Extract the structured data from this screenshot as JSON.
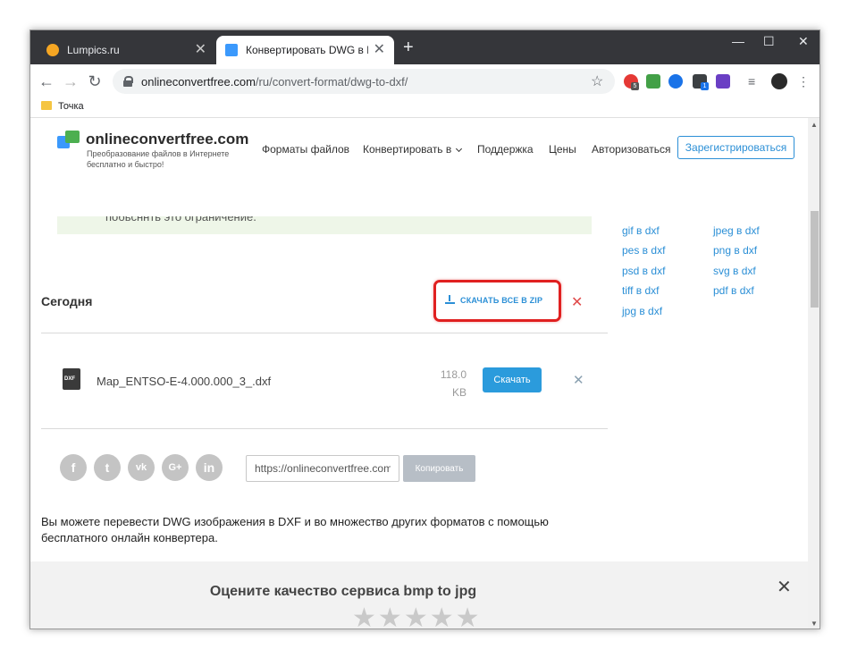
{
  "browser": {
    "tabs": [
      {
        "label": "Lumpics.ru",
        "favicon_color": "#f5a623"
      },
      {
        "label": "Конвертировать DWG в DXF он",
        "favicon_color": "#3b99fc"
      }
    ],
    "new_tab": "+",
    "window_controls": {
      "minimize": "—",
      "maximize": "☐",
      "close": "✕"
    },
    "address": {
      "host": "onlineconvertfree.com",
      "path": "/ru/convert-format/dwg-to-dxf/"
    },
    "extension_badges": [
      "5",
      "1"
    ],
    "bookmarks": [
      {
        "label": "Точка"
      }
    ]
  },
  "site": {
    "logo": {
      "name": "onlineconvertfree.com",
      "tagline": "Преобразование файлов в Интернете бесплатно и быстро!"
    },
    "nav": {
      "formats": "Форматы файлов",
      "convert": "Конвертировать в",
      "support": "Поддержка",
      "prices": "Цены",
      "login": "Авторизоваться",
      "register": "Зарегистрироваться"
    },
    "notice_text": "побьсннть это ограничение.",
    "conversions": [
      {
        "label": "gif в dxf"
      },
      {
        "label": "jpeg в dxf"
      },
      {
        "label": "pes в dxf"
      },
      {
        "label": "png в dxf"
      },
      {
        "label": "psd в dxf"
      },
      {
        "label": "svg в dxf"
      },
      {
        "label": "tiff в dxf"
      },
      {
        "label": "pdf в dxf"
      },
      {
        "label": "jpg в dxf"
      }
    ],
    "today": {
      "title": "Сегодня",
      "zip_button": "СКАЧАТЬ ВСЕ В ZIP",
      "files": [
        {
          "icon_label": "DXF",
          "name": "Map_ENTSO-E-4.000.000_3_.dxf",
          "size_value": "118.0",
          "size_unit": "KB",
          "download": "Скачать"
        }
      ]
    },
    "share": {
      "networks": [
        "f",
        "t",
        "vk",
        "G+",
        "in"
      ],
      "url_value": "https://onlineconvertfree.com",
      "copy_button": "Копировать"
    },
    "description": "Вы можете перевести DWG изображения в DXF и во множество других форматов с помощью бесплатного онлайн конвертера.",
    "rating": {
      "title": "Оцените качество сервиса bmp to jpg",
      "close": "✕",
      "stars_total": 5,
      "stars_selected": 0
    }
  },
  "colors": {
    "accent": "#2b8fd6",
    "highlight": "#e02020",
    "chrome_dark": "#35363a"
  }
}
